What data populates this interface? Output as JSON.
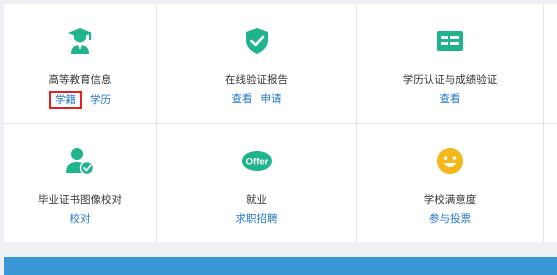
{
  "colors": {
    "accent_green": "#20b48c",
    "link_blue": "#2277c9",
    "highlight_red": "#e22222",
    "banner_blue": "#3a97d6",
    "smile_yellow": "#f5b71a"
  },
  "services": [
    {
      "title": "高等教育信息",
      "icon": "graduate-icon",
      "links": [
        "学籍",
        "学历"
      ]
    },
    {
      "title": "在线验证报告",
      "icon": "shield-check-icon",
      "links": [
        "查看",
        "申请"
      ]
    },
    {
      "title": "学历认证与成绩验证",
      "icon": "id-card-icon",
      "links": [
        "查看"
      ]
    },
    {
      "title": "毕业证书图像校对",
      "icon": "user-verified-icon",
      "links": [
        "校对"
      ]
    },
    {
      "title": "就业",
      "icon": "offer-badge-icon",
      "badge_text": "Offer",
      "links": [
        "求职招聘"
      ]
    },
    {
      "title": "学校满意度",
      "icon": "smiley-icon",
      "links": [
        "参与投票"
      ]
    }
  ]
}
